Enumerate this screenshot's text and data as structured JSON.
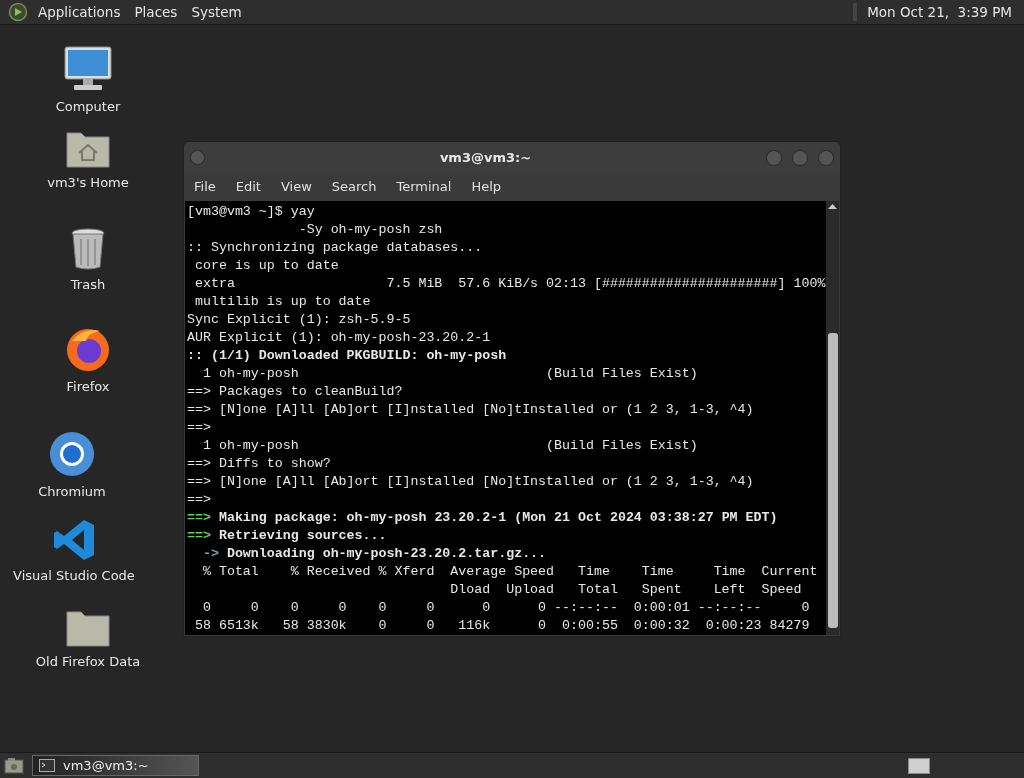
{
  "top_panel": {
    "menus": [
      "Applications",
      "Places",
      "System"
    ],
    "clock": "Mon Oct 21,  3:39 PM"
  },
  "desktop_icons": [
    {
      "kind": "monitor",
      "label": "Computer"
    },
    {
      "kind": "home_folder",
      "label": "vm3's Home"
    },
    {
      "kind": "trash",
      "label": "Trash"
    },
    {
      "kind": "browser_orange",
      "label": "Firefox"
    },
    {
      "kind": "browser_blue",
      "label": "Chromium"
    },
    {
      "kind": "code_editor",
      "label": "Visual Studio Code"
    },
    {
      "kind": "folder",
      "label": "Old Firefox Data"
    }
  ],
  "window": {
    "title": "vm3@vm3:~",
    "menu": [
      "File",
      "Edit",
      "View",
      "Search",
      "Terminal",
      "Help"
    ],
    "terminal_lines": [
      {
        "kind": "plain",
        "text": "[vm3@vm3 ~]$ yay"
      },
      {
        "kind": "plain",
        "text": "              -Sy oh-my-posh zsh"
      },
      {
        "kind": "plain",
        "text": ":: Synchronizing package databases..."
      },
      {
        "kind": "plain",
        "text": " core is up to date"
      },
      {
        "kind": "plain",
        "text": " extra                   7.5 MiB  57.6 KiB/s 02:13 [######################] 100%"
      },
      {
        "kind": "plain",
        "text": " multilib is up to date"
      },
      {
        "kind": "plain",
        "text": "Sync Explicit (1): zsh-5.9-5"
      },
      {
        "kind": "plain",
        "text": "AUR Explicit (1): oh-my-posh-23.20.2-1"
      },
      {
        "kind": "bold",
        "text": ":: (1/1) Downloaded PKGBUILD: oh-my-posh"
      },
      {
        "kind": "plain",
        "text": "  1 oh-my-posh                               (Build Files Exist)"
      },
      {
        "kind": "plain",
        "text": "==> Packages to cleanBuild?"
      },
      {
        "kind": "plain",
        "text": "==> [N]one [A]ll [Ab]ort [I]nstalled [No]tInstalled or (1 2 3, 1-3, ^4)"
      },
      {
        "kind": "plain",
        "text": "==>"
      },
      {
        "kind": "plain",
        "text": "  1 oh-my-posh                               (Build Files Exist)"
      },
      {
        "kind": "plain",
        "text": "==> Diffs to show?"
      },
      {
        "kind": "plain",
        "text": "==> [N]one [A]ll [Ab]ort [I]nstalled [No]tInstalled or (1 2 3, 1-3, ^4)"
      },
      {
        "kind": "plain",
        "text": "==>"
      },
      {
        "kind": "step",
        "marker": "==>",
        "text": "Making package: oh-my-posh 23.20.2-1 (Mon 21 Oct 2024 03:38:27 PM EDT)"
      },
      {
        "kind": "step",
        "marker": "==>",
        "text": "Retrieving sources..."
      },
      {
        "kind": "substep",
        "marker": "  ->",
        "text": "Downloading oh-my-posh-23.20.2.tar.gz..."
      },
      {
        "kind": "plain",
        "text": "  % Total    % Received % Xferd  Average Speed   Time    Time     Time  Current"
      },
      {
        "kind": "plain",
        "text": "                                 Dload  Upload   Total   Spent    Left  Speed"
      },
      {
        "kind": "plain",
        "text": "  0     0    0     0    0     0      0      0 --:--:--  0:00:01 --:--:--     0"
      },
      {
        "kind": "plain",
        "text": " 58 6513k   58 3830k    0     0   116k      0  0:00:55  0:00:32  0:00:23 84279"
      }
    ]
  },
  "taskbar": {
    "tasks": [
      {
        "label": "vm3@vm3:~",
        "selected": true
      }
    ]
  }
}
